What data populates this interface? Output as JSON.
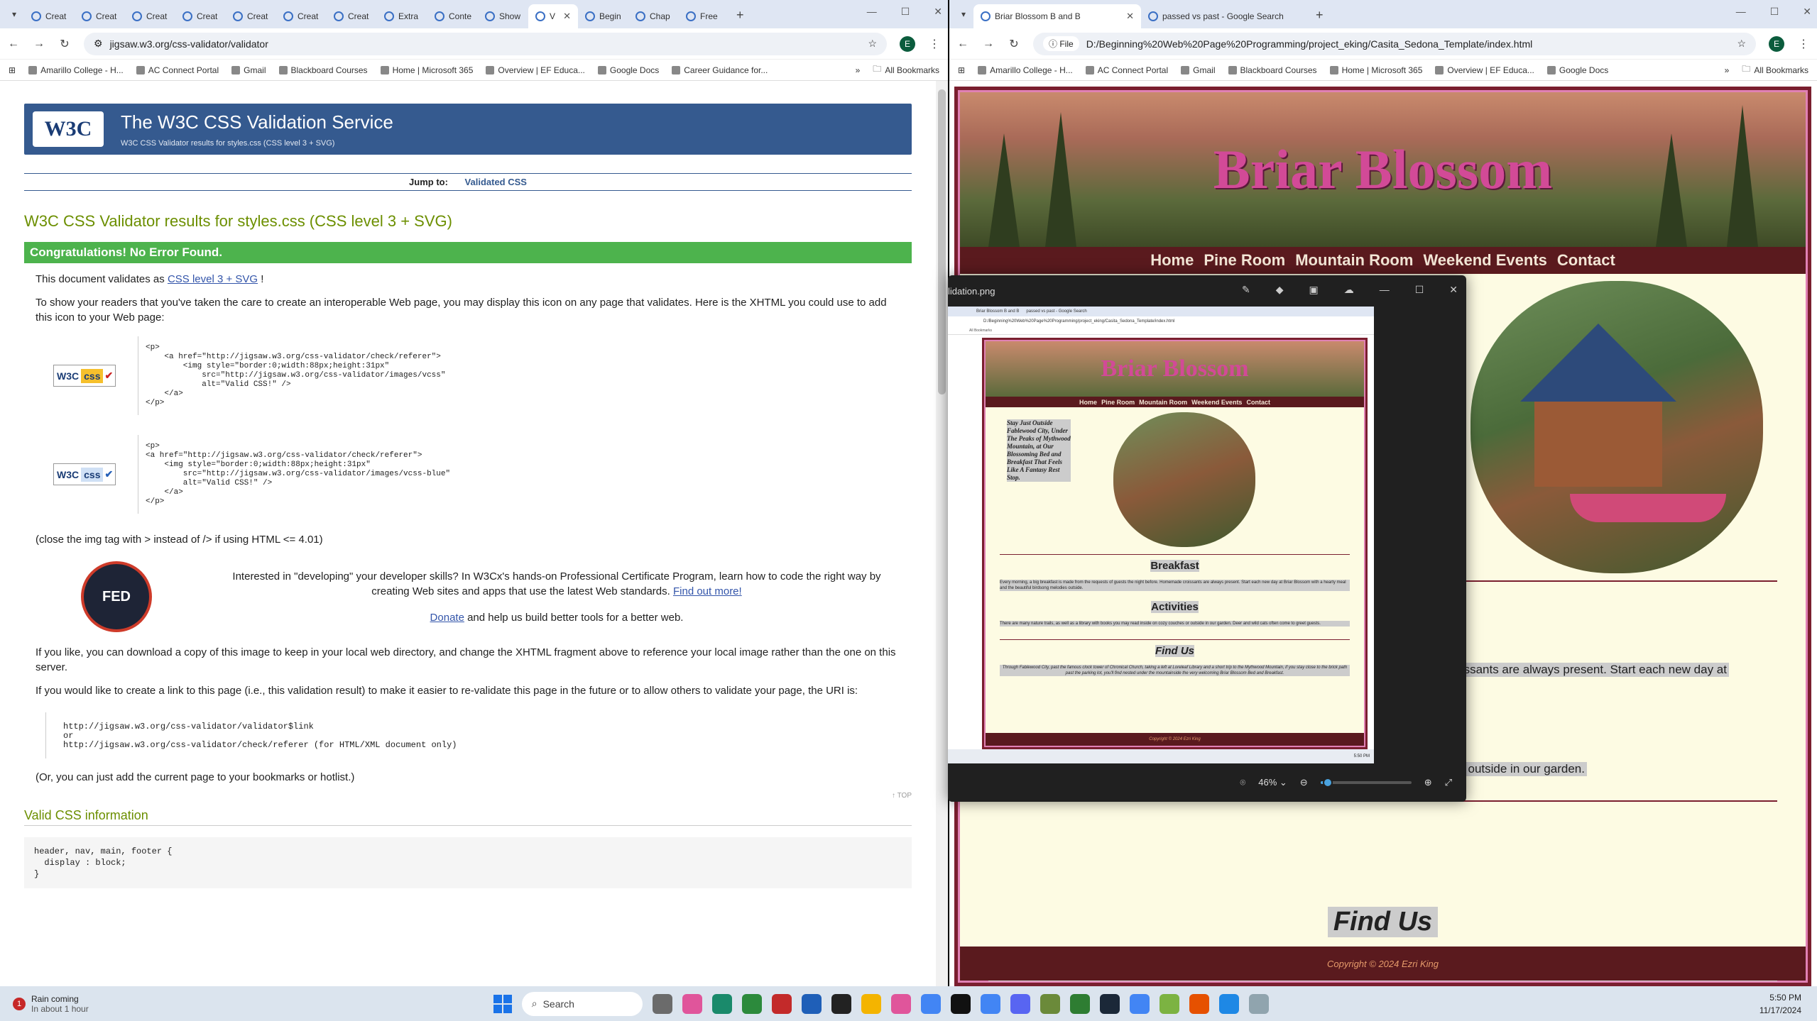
{
  "left_browser": {
    "tabs": [
      {
        "label": "Creat"
      },
      {
        "label": "Creat"
      },
      {
        "label": "Creat"
      },
      {
        "label": "Creat"
      },
      {
        "label": "Creat"
      },
      {
        "label": "Creat"
      },
      {
        "label": "Creat"
      },
      {
        "label": "Extra"
      },
      {
        "label": "Conte"
      },
      {
        "label": "Show"
      },
      {
        "label": "V"
      },
      {
        "label": "Begin"
      },
      {
        "label": "Chap"
      },
      {
        "label": "Free"
      }
    ],
    "url": "jigsaw.w3.org/css-validator/validator",
    "bookmarks": [
      "Amarillo College - H...",
      "AC Connect Portal",
      "Gmail",
      "Blackboard Courses",
      "Home | Microsoft 365",
      "Overview | EF Educa...",
      "Google Docs",
      "Career Guidance for..."
    ],
    "all_bookmarks": "All Bookmarks",
    "profile_initial": "E"
  },
  "w3c": {
    "logo": "W3C",
    "title": "The W3C CSS Validation Service",
    "subtitle": "W3C CSS Validator results for styles.css (CSS level 3 + SVG)",
    "jump_label": "Jump to:",
    "jump_link": "Validated CSS",
    "results_heading": "W3C CSS Validator results for styles.css (CSS level 3 + SVG)",
    "congrats": "Congratulations! No Error Found.",
    "validates_pre": "This document validates as",
    "validates_link": "CSS level 3 + SVG",
    "validates_post": "!",
    "show_readers": "To show your readers that you've taken the care to create an interoperable Web page, you may display this icon on any page that validates. Here is the XHTML you could use to add this icon to your Web page:",
    "code1": "<p>\n    <a href=\"http://jigsaw.w3.org/css-validator/check/referer\">\n        <img style=\"border:0;width:88px;height:31px\"\n            src=\"http://jigsaw.w3.org/css-validator/images/vcss\"\n            alt=\"Valid CSS!\" />\n    </a>\n</p>",
    "code2": "<p>\n<a href=\"http://jigsaw.w3.org/css-validator/check/referer\">\n    <img style=\"border:0;width:88px;height:31px\"\n        src=\"http://jigsaw.w3.org/css-validator/images/vcss-blue\"\n        alt=\"Valid CSS!\" />\n    </a>\n</p>",
    "badge_w3c": "W3C",
    "badge_css": "css",
    "close_tag_note": "(close the img tag with > instead of /> if using HTML <= 4.01)",
    "promo_text": "Interested in \"developing\" your developer skills? In W3Cx's hands-on Professional Certificate Program, learn how to code the right way by creating Web sites and apps that use the latest Web standards.",
    "promo_link": "Find out more!",
    "donate_link": "Donate",
    "donate_text": "and help us build better tools for a better web.",
    "medal_letters": "FED",
    "download_note": "If you like, you can download a copy of this image to keep in your local web directory, and change the XHTML fragment above to reference your local image rather than the one on this server.",
    "link_note": "If you would like to create a link to this page (i.e., this validation result) to make it easier to re-validate this page in the future or to allow others to validate your page, the URI is:",
    "uri_block": "http://jigsaw.w3.org/css-validator/validator$link\nor\nhttp://jigsaw.w3.org/css-validator/check/referer (for HTML/XML document only)",
    "bookmark_note": "(Or, you can just add the current page to your bookmarks or hotlist.)",
    "top_link": "↑ TOP",
    "valid_css_heading": "Valid CSS information",
    "css_code": "header, nav, main, footer {\n  display : block;\n}"
  },
  "right_browser": {
    "tabs": [
      {
        "label": "Briar Blossom B and B"
      },
      {
        "label": "passed vs past - Google Search"
      }
    ],
    "file_chip": "File",
    "url": "D:/Beginning%20Web%20Page%20Programming/project_eking/Casita_Sedona_Template/index.html",
    "bookmarks": [
      "Amarillo College - H...",
      "AC Connect Portal",
      "Gmail",
      "Blackboard Courses",
      "Home | Microsoft 365",
      "Overview | EF Educa...",
      "Google Docs"
    ],
    "all_bookmarks": "All Bookmarks",
    "profile_initial": "E"
  },
  "site": {
    "title": "Briar Blossom",
    "nav": [
      "Home",
      "Pine Room",
      "Mountain Room",
      "Weekend Events",
      "Contact"
    ],
    "tagline": "Stay Just Outside Fablewood City, Under The Peaks of Mythwood Mountain, at Our Blossoming Bed and Breakfast That Feels Like A Fantasy Rest Stop.",
    "breakfast_heading": "Breakfast",
    "breakfast_text": "Every morning, a big breakfast is made from the requests of guests the night before. Homemade croissants are always present. Start each new day at Briar Blossom with a hearty meal and the beautiful birdsong melodies outside.",
    "breakfast_fragment": "e croissants are always present. Start each new day at",
    "activities_heading": "Activities",
    "activities_text": "There are many nature trails, as well as a library with books you may read inside on cozy couches or outside in our garden. Deer and wild cats often come to greet guests.",
    "activities_fragment": "es or outside in our garden.",
    "findus_heading": "Find Us",
    "findus_text": "Through Fablewood City, past the famous clock tower of Chronical Church, taking a left at Loreleaf Library and a short trip to the Mythwood Mountain, if you stay close to the brick path past the parking lot, you'll find nested under the mountainside the very welcoming Briar Blossom Bed and Breakfast.",
    "footer": "Copyright © 2024 Ezri King"
  },
  "viewer": {
    "title": "lidation.png",
    "zoom": "46%",
    "zoom_level": 0.05
  },
  "taskbar": {
    "weather_title": "Rain coming",
    "weather_sub": "In about 1 hour",
    "weather_badge": "1",
    "search": "Search",
    "time": "5:50 PM",
    "date": "11/17/2024"
  }
}
